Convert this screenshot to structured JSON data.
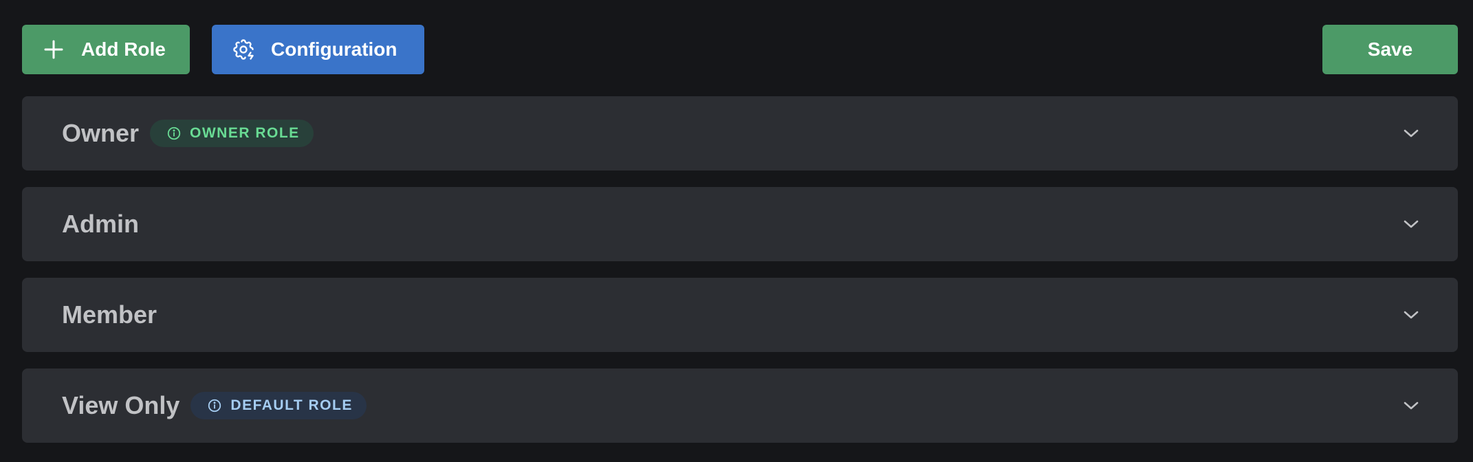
{
  "toolbar": {
    "add_role_label": "Add Role",
    "add_role_icon": "plus-icon",
    "configuration_label": "Configuration",
    "configuration_icon": "gear-bolt-icon",
    "save_label": "Save"
  },
  "roles": [
    {
      "name": "Owner",
      "badge": "OWNER ROLE",
      "badge_icon": "info-circle-icon",
      "expanded": false
    },
    {
      "name": "Admin",
      "badge": "",
      "expanded": false
    },
    {
      "name": "Member",
      "badge": "",
      "expanded": false
    },
    {
      "name": "View Only",
      "badge": "DEFAULT ROLE",
      "badge_icon": "info-circle-icon",
      "expanded": false
    }
  ],
  "colors": {
    "background": "#151619",
    "row_background": "#2c2e33",
    "green_button": "#4c9a67",
    "blue_button": "#3a74c9",
    "owner_badge_bg": "#28403a",
    "owner_badge_text": "#69db94",
    "default_badge_bg": "#283447",
    "default_badge_text": "#a5cdf2"
  }
}
